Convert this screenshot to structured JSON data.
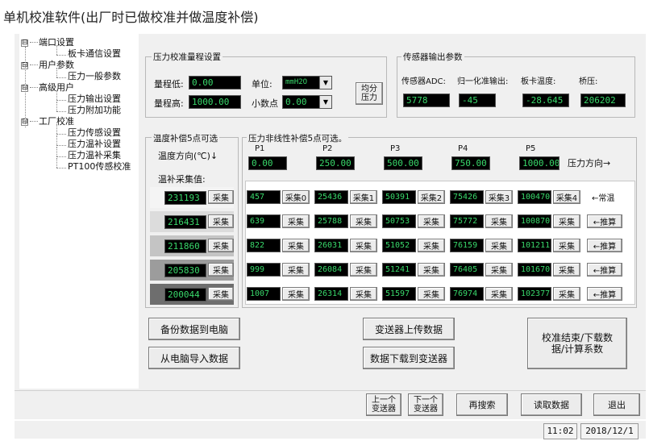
{
  "window_title": "单机校准软件(出厂时已做校准并做温度补偿)",
  "tree": {
    "items": [
      {
        "label": "端口设置",
        "level": 0,
        "expand": "⊟"
      },
      {
        "label": "板卡通信设置",
        "level": 1
      },
      {
        "label": "用户参数",
        "level": 0,
        "expand": "⊟"
      },
      {
        "label": "压力一般参数",
        "level": 1
      },
      {
        "label": "高级用户",
        "level": 0,
        "expand": "⊟"
      },
      {
        "label": "压力输出设置",
        "level": 1
      },
      {
        "label": "压力附加功能",
        "level": 1
      },
      {
        "label": "工厂校准",
        "level": 0,
        "expand": "⊟"
      },
      {
        "label": "压力传感设置",
        "level": 1
      },
      {
        "label": "压力温补设置",
        "level": 1
      },
      {
        "label": "压力温补采集",
        "level": 1
      },
      {
        "label": "PT100传感校准",
        "level": 1
      }
    ]
  },
  "range_group": {
    "title": "压力校准量程设置",
    "low_label": "量程低:",
    "low_value": "0.00",
    "high_label": "量程高:",
    "high_value": "1000.00",
    "unit_label": "单位:",
    "unit_value": "mmH2O",
    "decimal_label": "小数点",
    "decimal_value": "0.00",
    "split_button": "均分\n压力"
  },
  "sensor_group": {
    "title": "传感器输出参数",
    "labels": [
      "传感器ADC:",
      "归一化准输出:",
      "板卡温度:",
      "桥压:"
    ],
    "values": [
      "5778",
      "-45",
      "-28.645",
      "206202"
    ]
  },
  "temp_group": {
    "title": "温度补偿5点可选",
    "direction": "温度方向(℃)↓",
    "collect_label": "温补采集值:",
    "values": [
      "231193",
      "216431",
      "211860",
      "205830",
      "200044"
    ],
    "collect_button": "采集"
  },
  "nonlin_group": {
    "title": "压力非线性补偿5点可选。",
    "points": [
      "P1",
      "P2",
      "P3",
      "P4",
      "P5"
    ],
    "point_values": [
      "0.00",
      "250.00",
      "500.00",
      "750.00",
      "1000.00"
    ],
    "direction": "压力方向→",
    "rows": [
      {
        "cells": [
          [
            "457",
            "采集0"
          ],
          [
            "25436",
            "采集1"
          ],
          [
            "50391",
            "采集2"
          ],
          [
            "75426",
            "采集3"
          ],
          [
            "100470",
            "采集4"
          ]
        ],
        "action": "←常温",
        "action_is_button": false
      },
      {
        "cells": [
          [
            "639",
            "采集"
          ],
          [
            "25788",
            "采集"
          ],
          [
            "50753",
            "采集"
          ],
          [
            "75772",
            "采集"
          ],
          [
            "100870",
            "采集"
          ]
        ],
        "action": "←推算",
        "action_is_button": true
      },
      {
        "cells": [
          [
            "822",
            "采集"
          ],
          [
            "26031",
            "采集"
          ],
          [
            "51052",
            "采集"
          ],
          [
            "76159",
            "采集"
          ],
          [
            "101211",
            "采集"
          ]
        ],
        "action": "←推算",
        "action_is_button": true
      },
      {
        "cells": [
          [
            "999",
            "采集"
          ],
          [
            "26084",
            "采集"
          ],
          [
            "51241",
            "采集"
          ],
          [
            "76405",
            "采集"
          ],
          [
            "101670",
            "采集"
          ]
        ],
        "action": "←推算",
        "action_is_button": true
      },
      {
        "cells": [
          [
            "1007",
            "采集"
          ],
          [
            "26314",
            "采集"
          ],
          [
            "51597",
            "采集"
          ],
          [
            "76974",
            "采集"
          ],
          [
            "102377",
            "采集"
          ]
        ],
        "action": "←推算",
        "action_is_button": true
      }
    ]
  },
  "actions": {
    "backup": "备份数据到电脑",
    "import": "从电脑导入数据",
    "upload": "变送器上传数据",
    "download": "数据下载到变送器",
    "finish": "校准结束/下载数\n据/计算系数"
  },
  "bottom": {
    "prev": "上一个\n变送器",
    "next": "下一个\n变送器",
    "research": "再搜索",
    "read": "读取数据",
    "exit": "退出"
  },
  "status": {
    "time": "11:02",
    "date": "2018/12/1"
  }
}
